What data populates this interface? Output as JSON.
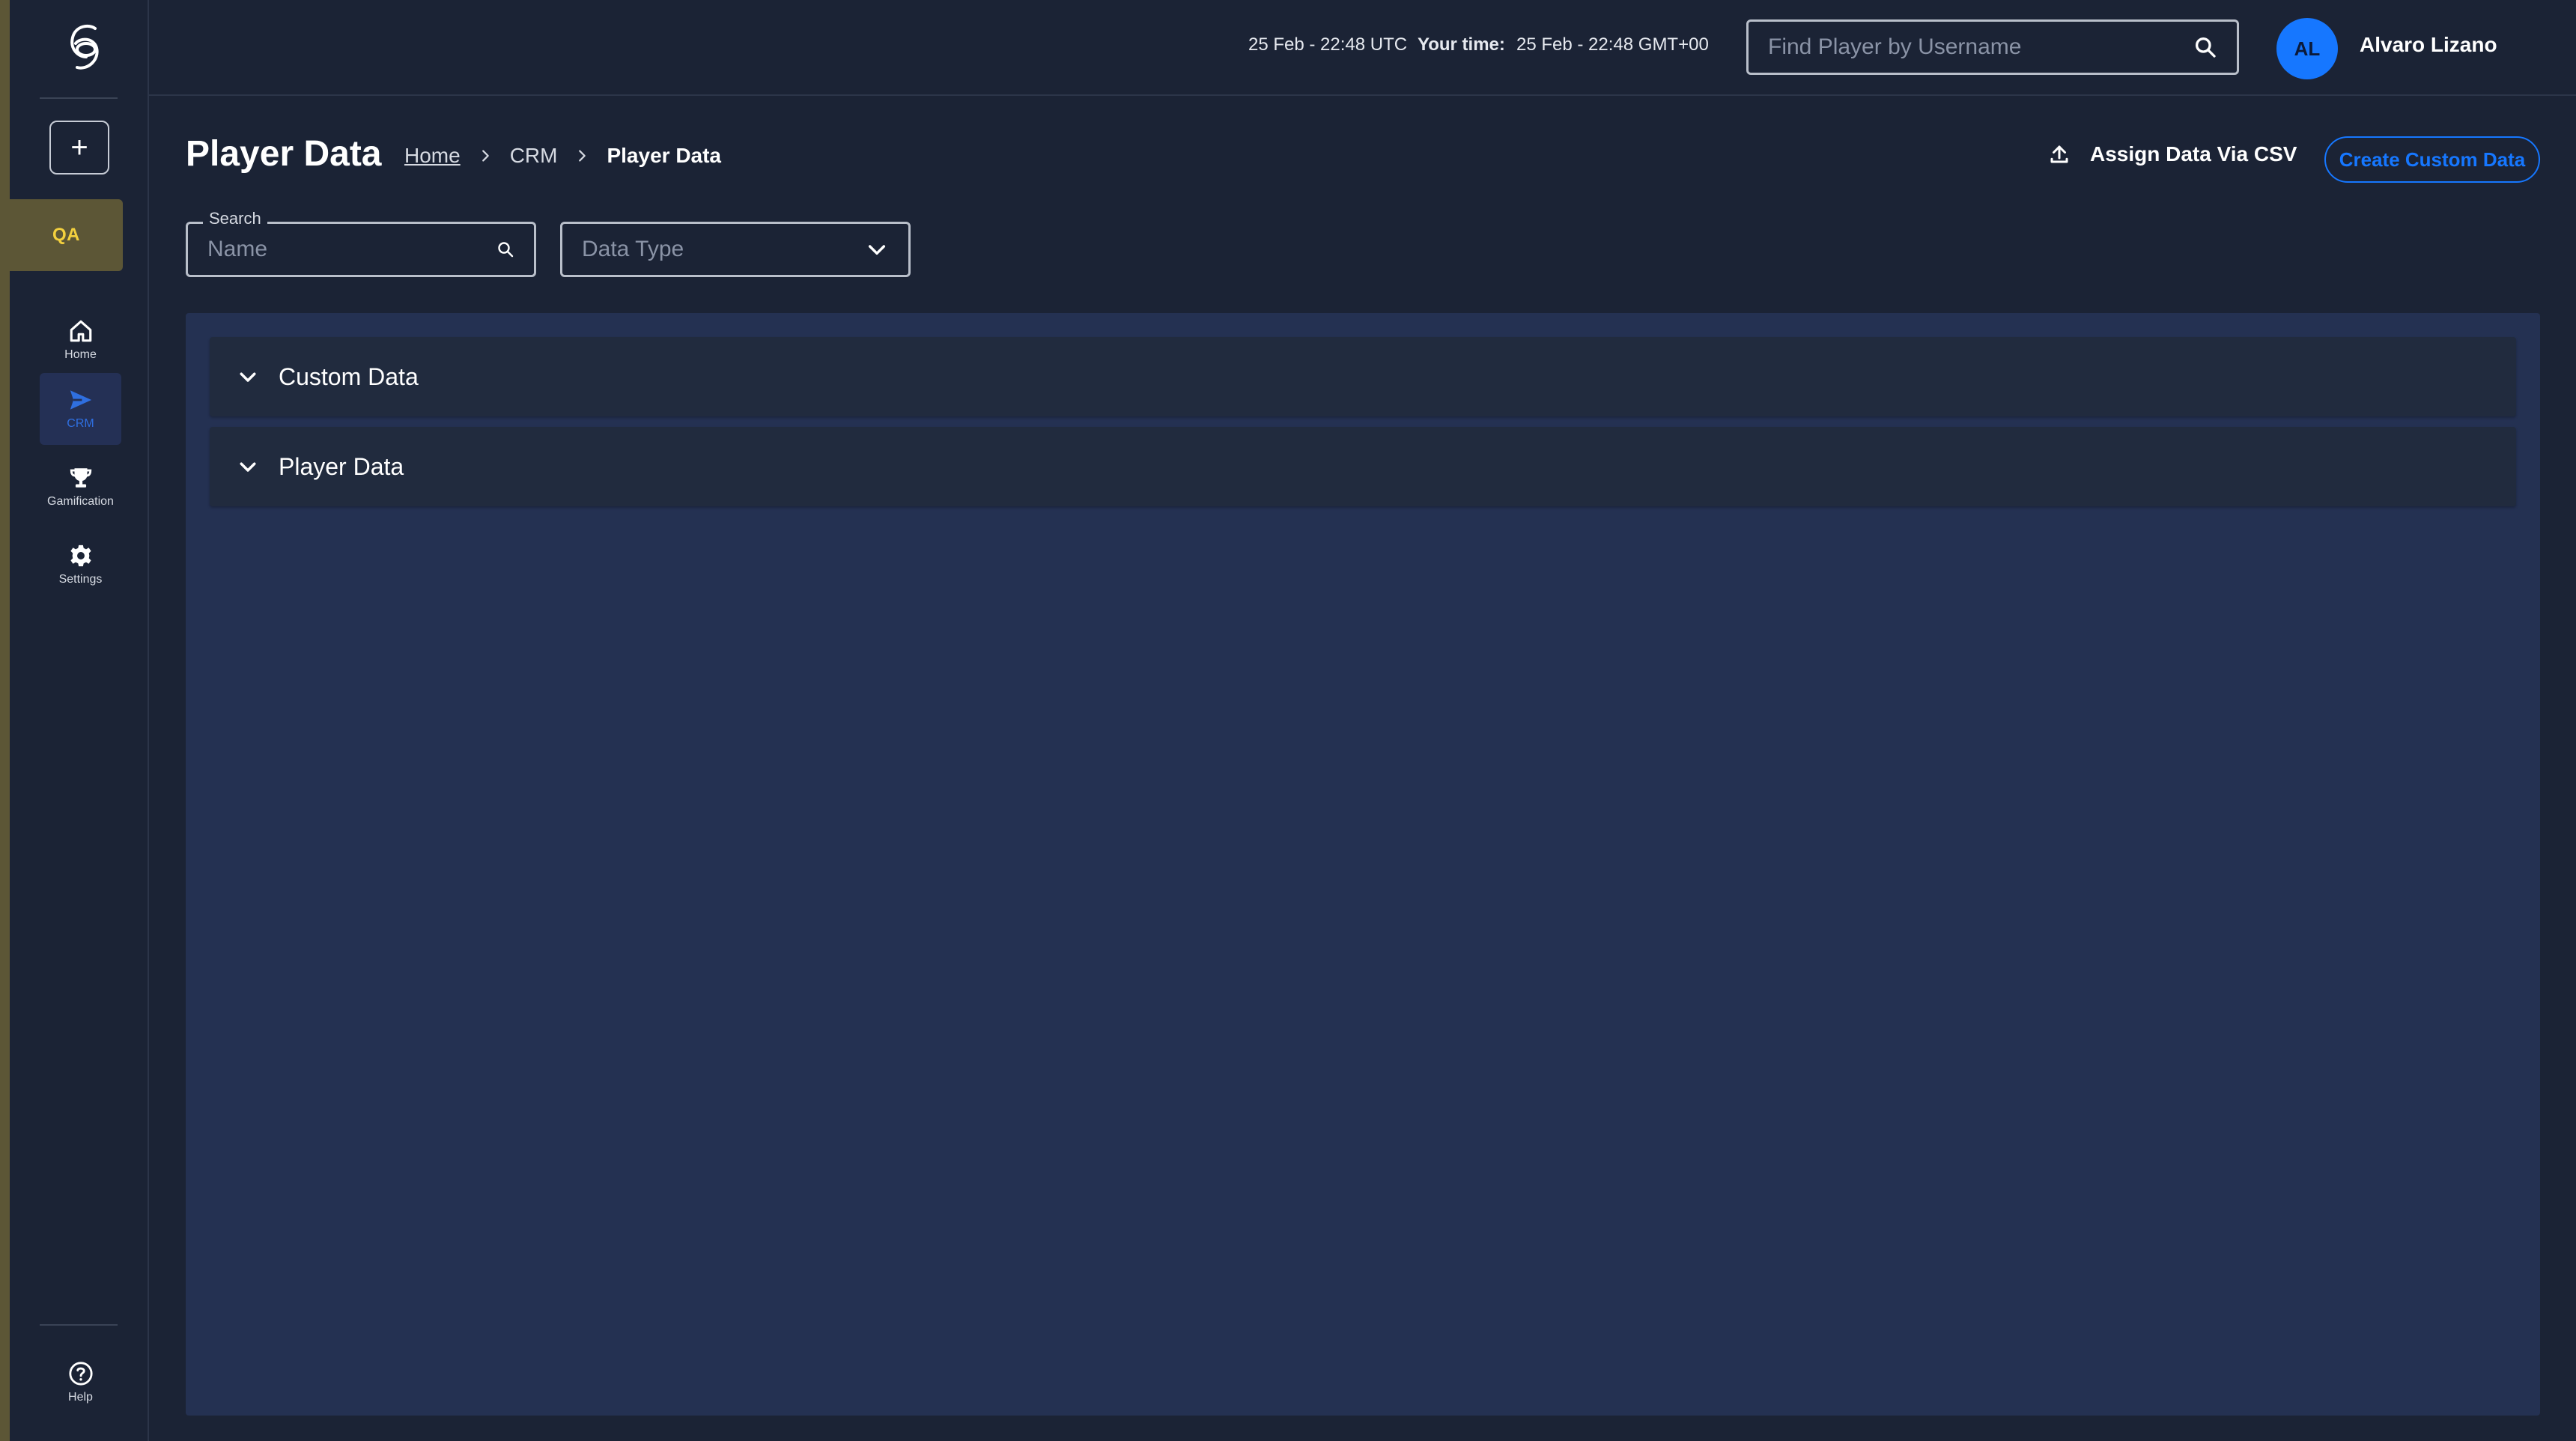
{
  "app": {
    "logo_icon": "brand-g-logo-icon",
    "env_badge": "QA",
    "accent_color": "#1677ff",
    "env_color": "#f3d03e"
  },
  "sidebar": {
    "create_label": "+",
    "items": [
      {
        "label": "Home",
        "icon": "home-icon"
      },
      {
        "label": "CRM",
        "icon": "send-icon",
        "active": true
      },
      {
        "label": "Gamification",
        "icon": "trophy-icon"
      },
      {
        "label": "Settings",
        "icon": "gear-icon"
      }
    ],
    "help_label": "Help"
  },
  "topbar": {
    "utc_time": "25 Feb - 22:48 UTC",
    "your_time_label": "Your time:",
    "local_time": "25 Feb - 22:48 GMT+00",
    "find_player_placeholder": "Find Player by Username",
    "user_initials": "AL",
    "user_name": "Alvaro Lizano"
  },
  "header": {
    "title": "Player Data",
    "breadcrumb": [
      "Home",
      "CRM",
      "Player Data"
    ],
    "assign_csv_label": "Assign Data Via CSV",
    "create_custom_label": "Create Custom Data"
  },
  "filters": {
    "search_legend": "Search",
    "search_placeholder": "Name",
    "data_type_placeholder": "Data Type"
  },
  "sections": [
    {
      "label": "Custom Data"
    },
    {
      "label": "Player Data"
    }
  ]
}
